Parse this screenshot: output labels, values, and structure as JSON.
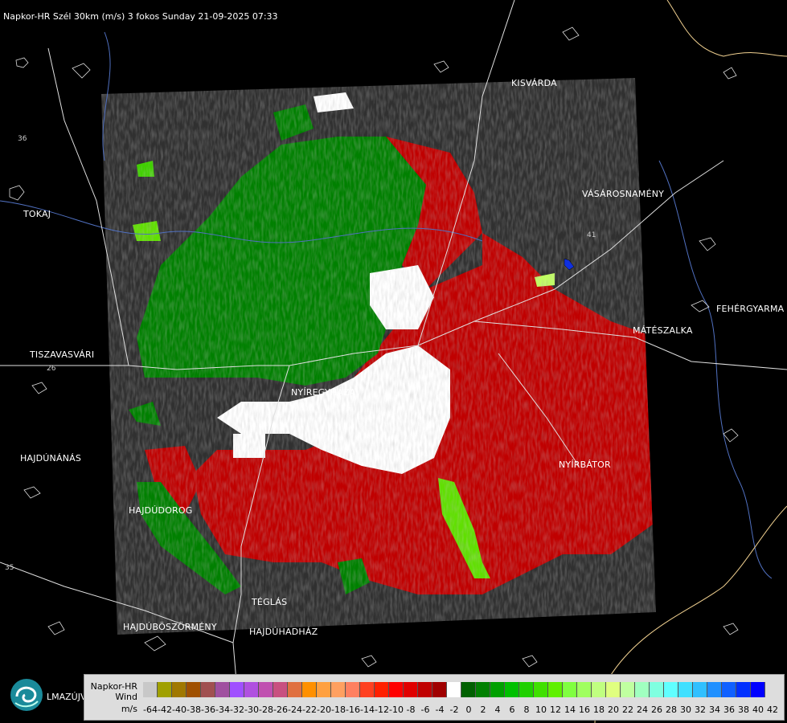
{
  "header": {
    "title": "Napkor-HR Szél 30km (m/s) 3 fokos Sunday 21-09-2025 07:33"
  },
  "towns": {
    "kisvarda": "KISVÁRDA",
    "tokaj": "TOKAJ",
    "vasarosnameny": "VÁSÁROSNAMÉNY",
    "fehergyarmat": "FEHÉRGYARMA",
    "mateszalka": "MÁTÉSZALKA",
    "tiszavasvari": "TISZAVASVÁRI",
    "nyiregyhaza": "NYÍREGYHÁZA",
    "hajdunanas": "HAJDÚNÁNÁS",
    "nyirbator": "NYÍRBÁTOR",
    "hajdudorog": "HAJDÚDOROG",
    "teglas": "TÉGLÁS",
    "hajduboszormeny": "HAJDÚBÖSZÖRMÉNY",
    "hajduhadhaz": "HAJDÚHADHÁZ"
  },
  "roads": {
    "r1": "36",
    "r2": "26",
    "r3": "35",
    "r4": "41"
  },
  "branding": {
    "logo_text": "LMAZÚJVÁR"
  },
  "legend": {
    "name_line1": "Napkor-HR",
    "name_line2": "Wind",
    "unit": "m/s",
    "colors": [
      "#c8c8c8",
      "#a0a000",
      "#a07800",
      "#a05000",
      "#a05050",
      "#a050a0",
      "#a050ff",
      "#b050e0",
      "#c050b0",
      "#c85080",
      "#e07040",
      "#ff9000",
      "#ffa040",
      "#ffa060",
      "#ff8060",
      "#ff4020",
      "#ff2000",
      "#ff0000",
      "#e00000",
      "#c00000",
      "#a00000",
      "#ffffff",
      "#006000",
      "#008000",
      "#00a000",
      "#00c000",
      "#20d000",
      "#40e000",
      "#60f000",
      "#80ff40",
      "#a0ff60",
      "#c0ff80",
      "#e0ff80",
      "#c0ffa0",
      "#a0ffc0",
      "#80ffe0",
      "#60ffff",
      "#40e0ff",
      "#30c0ff",
      "#2090ff",
      "#1060ff",
      "#0030ff",
      "#0000ff"
    ],
    "ticks": [
      "-64",
      "-42",
      "-40",
      "-38",
      "-36",
      "-34",
      "-32",
      "-30",
      "-28",
      "-26",
      "-24",
      "-22",
      "-20",
      "-18",
      "-16",
      "-14",
      "-12",
      "-10",
      "-8",
      "-6",
      "-4",
      "-2",
      "0",
      "2",
      "4",
      "6",
      "8",
      "10",
      "12",
      "14",
      "16",
      "18",
      "20",
      "22",
      "24",
      "26",
      "28",
      "30",
      "32",
      "34",
      "36",
      "38",
      "40",
      "42"
    ]
  }
}
